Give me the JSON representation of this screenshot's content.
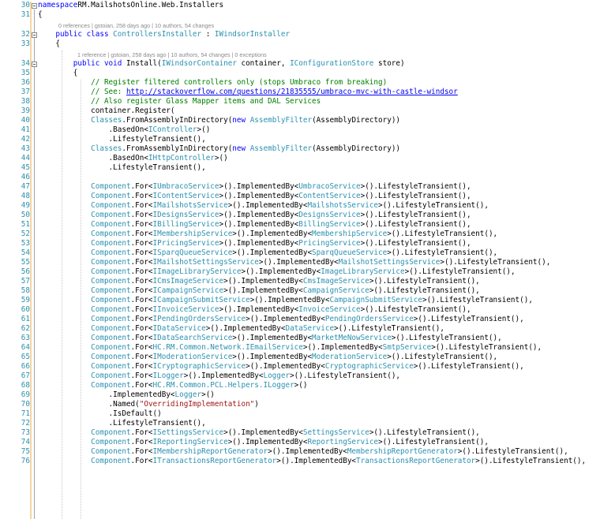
{
  "lines": [
    {
      "n": "30",
      "segs": [
        [
          "k",
          "namespace"
        ],
        [
          "",
          "RM.MailshotsOnline.Web.Installers"
        ]
      ]
    },
    {
      "n": "31",
      "segs": [
        [
          "",
          "{"
        ]
      ]
    },
    {
      "n": "32",
      "segs": [
        [
          "",
          "    "
        ],
        [
          "k",
          "public class"
        ],
        [
          "",
          ""
        ],
        [
          "t",
          "ControllersInstaller"
        ],
        [
          "",
          " : "
        ],
        [
          "t",
          "IWindsorInstaller"
        ]
      ]
    },
    {
      "n": "33",
      "segs": [
        [
          "",
          "    {"
        ]
      ]
    },
    {
      "n": "34",
      "segs": [
        [
          "",
          "        "
        ],
        [
          "k",
          "public void"
        ],
        [
          "",
          " Install("
        ],
        [
          "t",
          "IWindsorContainer"
        ],
        [
          "",
          " container, "
        ],
        [
          "t",
          "IConfigurationStore"
        ],
        [
          "",
          " store)"
        ]
      ]
    },
    {
      "n": "35",
      "segs": [
        [
          "",
          "        {"
        ]
      ]
    },
    {
      "n": "36",
      "segs": [
        [
          "",
          "            "
        ],
        [
          "c",
          "// Register filtered controllers only (stops Umbraco from breaking)"
        ]
      ]
    },
    {
      "n": "37",
      "segs": [
        [
          "",
          "            "
        ],
        [
          "c",
          "// See: "
        ],
        [
          "u",
          "http://stackoverflow.com/questions/21835555/umbraco-mvc-with-castle-windsor"
        ]
      ]
    },
    {
      "n": "38",
      "segs": [
        [
          "",
          "            "
        ],
        [
          "c",
          "// Also register Glass Mapper items and DAL Services"
        ]
      ]
    },
    {
      "n": "39",
      "segs": [
        [
          "",
          "            container.Register("
        ]
      ]
    },
    {
      "n": "40",
      "segs": [
        [
          "",
          "            "
        ],
        [
          "t",
          "Classes"
        ],
        [
          "",
          ".FromAssemblyInDirectory("
        ],
        [
          "k",
          "new"
        ],
        [
          "",
          " "
        ],
        [
          "t",
          "AssemblyFilter"
        ],
        [
          "",
          "(AssemblyDirectory))"
        ]
      ]
    },
    {
      "n": "41",
      "segs": [
        [
          "",
          "                .BasedOn<"
        ],
        [
          "t",
          "IController"
        ],
        [
          "",
          ">()"
        ]
      ]
    },
    {
      "n": "42",
      "segs": [
        [
          "",
          "                .LifestyleTransient(),"
        ]
      ]
    },
    {
      "n": "43",
      "segs": [
        [
          "",
          "            "
        ],
        [
          "t",
          "Classes"
        ],
        [
          "",
          ".FromAssemblyInDirectory("
        ],
        [
          "k",
          "new"
        ],
        [
          "",
          " "
        ],
        [
          "t",
          "AssemblyFilter"
        ],
        [
          "",
          "(AssemblyDirectory))"
        ]
      ]
    },
    {
      "n": "44",
      "segs": [
        [
          "",
          "                .BasedOn<"
        ],
        [
          "t",
          "IHttpController"
        ],
        [
          "",
          ">()"
        ]
      ]
    },
    {
      "n": "45",
      "segs": [
        [
          "",
          "                .LifestyleTransient(),"
        ]
      ]
    },
    {
      "n": "46",
      "segs": [
        [
          "",
          ""
        ]
      ]
    },
    {
      "n": "47",
      "segs": [
        [
          "",
          "            "
        ],
        [
          "t",
          "Component"
        ],
        [
          "",
          ".For<"
        ],
        [
          "t",
          "IUmbracoService"
        ],
        [
          "",
          ">().ImplementedBy<"
        ],
        [
          "t",
          "UmbracoService"
        ],
        [
          "",
          ">().LifestyleTransient(),"
        ]
      ]
    },
    {
      "n": "48",
      "segs": [
        [
          "",
          "            "
        ],
        [
          "t",
          "Component"
        ],
        [
          "",
          ".For<"
        ],
        [
          "t",
          "IContentService"
        ],
        [
          "",
          ">().ImplementedBy<"
        ],
        [
          "t",
          "ContentService"
        ],
        [
          "",
          ">().LifestyleTransient(),"
        ]
      ]
    },
    {
      "n": "49",
      "segs": [
        [
          "",
          "            "
        ],
        [
          "t",
          "Component"
        ],
        [
          "",
          ".For<"
        ],
        [
          "t",
          "IMailshotsService"
        ],
        [
          "",
          ">().ImplementedBy<"
        ],
        [
          "t",
          "MailshotsService"
        ],
        [
          "",
          ">().LifestyleTransient(),"
        ]
      ]
    },
    {
      "n": "50",
      "segs": [
        [
          "",
          "            "
        ],
        [
          "t",
          "Component"
        ],
        [
          "",
          ".For<"
        ],
        [
          "t",
          "IDesignsService"
        ],
        [
          "",
          ">().ImplementedBy<"
        ],
        [
          "t",
          "DesignsService"
        ],
        [
          "",
          ">().LifestyleTransient(),"
        ]
      ]
    },
    {
      "n": "51",
      "segs": [
        [
          "",
          "            "
        ],
        [
          "t",
          "Component"
        ],
        [
          "",
          ".For<"
        ],
        [
          "t",
          "IBillingService"
        ],
        [
          "",
          ">().ImplementedBy<"
        ],
        [
          "t",
          "BillingService"
        ],
        [
          "",
          ">().LifestyleTransient(),"
        ]
      ]
    },
    {
      "n": "52",
      "segs": [
        [
          "",
          "            "
        ],
        [
          "t",
          "Component"
        ],
        [
          "",
          ".For<"
        ],
        [
          "t",
          "IMembershipService"
        ],
        [
          "",
          ">().ImplementedBy<"
        ],
        [
          "t",
          "MembershipService"
        ],
        [
          "",
          ">().LifestyleTransient(),"
        ]
      ]
    },
    {
      "n": "53",
      "segs": [
        [
          "",
          "            "
        ],
        [
          "t",
          "Component"
        ],
        [
          "",
          ".For<"
        ],
        [
          "t",
          "IPricingService"
        ],
        [
          "",
          ">().ImplementedBy<"
        ],
        [
          "t",
          "PricingService"
        ],
        [
          "",
          ">().LifestyleTransient(),"
        ]
      ]
    },
    {
      "n": "54",
      "segs": [
        [
          "",
          "            "
        ],
        [
          "t",
          "Component"
        ],
        [
          "",
          ".For<"
        ],
        [
          "t",
          "ISparqQueueService"
        ],
        [
          "",
          ">().ImplementedBy<"
        ],
        [
          "t",
          "SparqQueueService"
        ],
        [
          "",
          ">().LifestyleTransient(),"
        ]
      ]
    },
    {
      "n": "55",
      "segs": [
        [
          "",
          "            "
        ],
        [
          "t",
          "Component"
        ],
        [
          "",
          ".For<"
        ],
        [
          "t",
          "IMailshotSettingsService"
        ],
        [
          "",
          ">().ImplementedBy<"
        ],
        [
          "t",
          "MailshotSettingsService"
        ],
        [
          "",
          ">().LifestyleTransient(),"
        ]
      ]
    },
    {
      "n": "56",
      "segs": [
        [
          "",
          "            "
        ],
        [
          "t",
          "Component"
        ],
        [
          "",
          ".For<"
        ],
        [
          "t",
          "IImageLibraryService"
        ],
        [
          "",
          ">().ImplementedBy<"
        ],
        [
          "t",
          "ImageLibraryService"
        ],
        [
          "",
          ">().LifestyleTransient(),"
        ]
      ]
    },
    {
      "n": "57",
      "segs": [
        [
          "",
          "            "
        ],
        [
          "t",
          "Component"
        ],
        [
          "",
          ".For<"
        ],
        [
          "t",
          "ICmsImageService"
        ],
        [
          "",
          ">().ImplementedBy<"
        ],
        [
          "t",
          "CmsImageService"
        ],
        [
          "",
          ">().LifestyleTransient(),"
        ]
      ]
    },
    {
      "n": "58",
      "segs": [
        [
          "",
          "            "
        ],
        [
          "t",
          "Component"
        ],
        [
          "",
          ".For<"
        ],
        [
          "t",
          "ICampaignService"
        ],
        [
          "",
          ">().ImplementedBy<"
        ],
        [
          "t",
          "CampaignService"
        ],
        [
          "",
          ">().LifestyleTransient(),"
        ]
      ]
    },
    {
      "n": "59",
      "segs": [
        [
          "",
          "            "
        ],
        [
          "t",
          "Component"
        ],
        [
          "",
          ".For<"
        ],
        [
          "t",
          "ICampaignSubmitService"
        ],
        [
          "",
          ">().ImplementedBy<"
        ],
        [
          "t",
          "CampaignSubmitService"
        ],
        [
          "",
          ">().LifestyleTransient(),"
        ]
      ]
    },
    {
      "n": "60",
      "segs": [
        [
          "",
          "            "
        ],
        [
          "t",
          "Component"
        ],
        [
          "",
          ".For<"
        ],
        [
          "t",
          "IInvoiceService"
        ],
        [
          "",
          ">().ImplementedBy<"
        ],
        [
          "t",
          "InvoiceService"
        ],
        [
          "",
          ">().LifestyleTransient(),"
        ]
      ]
    },
    {
      "n": "61",
      "segs": [
        [
          "",
          "            "
        ],
        [
          "t",
          "Component"
        ],
        [
          "",
          ".For<"
        ],
        [
          "t",
          "IPendingOrdersService"
        ],
        [
          "",
          ">().ImplementedBy<"
        ],
        [
          "t",
          "PendingOrdersService"
        ],
        [
          "",
          ">().LifestyleTransient(),"
        ]
      ]
    },
    {
      "n": "62",
      "segs": [
        [
          "",
          "            "
        ],
        [
          "t",
          "Component"
        ],
        [
          "",
          ".For<"
        ],
        [
          "t",
          "IDataService"
        ],
        [
          "",
          ">().ImplementedBy<"
        ],
        [
          "t",
          "DataService"
        ],
        [
          "",
          ">().LifestyleTransient(),"
        ]
      ]
    },
    {
      "n": "63",
      "segs": [
        [
          "",
          "            "
        ],
        [
          "t",
          "Component"
        ],
        [
          "",
          ".For<"
        ],
        [
          "t",
          "IDataSearchService"
        ],
        [
          "",
          ">().ImplementedBy<"
        ],
        [
          "t",
          "MarketMeNowService"
        ],
        [
          "",
          ">().LifestyleTransient(),"
        ]
      ]
    },
    {
      "n": "64",
      "segs": [
        [
          "",
          "            "
        ],
        [
          "t",
          "Component"
        ],
        [
          "",
          ".For<"
        ],
        [
          "t",
          "HC.RM.Common.Network."
        ],
        [
          "t",
          "IEmailService"
        ],
        [
          "",
          ">().ImplementedBy<"
        ],
        [
          "t",
          "SmtpService"
        ],
        [
          "",
          ">().LifestyleTransient(),"
        ]
      ]
    },
    {
      "n": "65",
      "segs": [
        [
          "",
          "            "
        ],
        [
          "t",
          "Component"
        ],
        [
          "",
          ".For<"
        ],
        [
          "t",
          "IModerationService"
        ],
        [
          "",
          ">().ImplementedBy<"
        ],
        [
          "t",
          "ModerationService"
        ],
        [
          "",
          ">().LifestyleTransient(),"
        ]
      ]
    },
    {
      "n": "66",
      "segs": [
        [
          "",
          "            "
        ],
        [
          "t",
          "Component"
        ],
        [
          "",
          ".For<"
        ],
        [
          "t",
          "ICryptographicService"
        ],
        [
          "",
          ">().ImplementedBy<"
        ],
        [
          "t",
          "CryptographicService"
        ],
        [
          "",
          ">().LifestyleTransient(),"
        ]
      ]
    },
    {
      "n": "67",
      "segs": [
        [
          "",
          "            "
        ],
        [
          "t",
          "Component"
        ],
        [
          "",
          ".For<"
        ],
        [
          "t",
          "ILogger"
        ],
        [
          "",
          ">().ImplementedBy<"
        ],
        [
          "t",
          "Logger"
        ],
        [
          "",
          ">().LifestyleTransient(),"
        ]
      ]
    },
    {
      "n": "68",
      "segs": [
        [
          "",
          "            "
        ],
        [
          "t",
          "Component"
        ],
        [
          "",
          ".For<"
        ],
        [
          "t",
          "HC.RM.Common.PCL.Helpers."
        ],
        [
          "t",
          "ILogger"
        ],
        [
          "",
          ">()"
        ]
      ]
    },
    {
      "n": "69",
      "segs": [
        [
          "",
          "                .ImplementedBy<"
        ],
        [
          "t",
          "Logger"
        ],
        [
          "",
          ">()"
        ]
      ]
    },
    {
      "n": "70",
      "segs": [
        [
          "",
          "                .Named("
        ],
        [
          "s",
          "\"OverridingImplementation\""
        ],
        [
          "",
          ")"
        ]
      ]
    },
    {
      "n": "71",
      "segs": [
        [
          "",
          "                .IsDefault()"
        ]
      ]
    },
    {
      "n": "72",
      "segs": [
        [
          "",
          "                .LifestyleTransient(),"
        ]
      ]
    },
    {
      "n": "73",
      "segs": [
        [
          "",
          "            "
        ],
        [
          "t",
          "Component"
        ],
        [
          "",
          ".For<"
        ],
        [
          "t",
          "ISettingsService"
        ],
        [
          "",
          ">().ImplementedBy<"
        ],
        [
          "t",
          "SettingsService"
        ],
        [
          "",
          ">().LifestyleTransient(),"
        ]
      ]
    },
    {
      "n": "74",
      "segs": [
        [
          "",
          "            "
        ],
        [
          "t",
          "Component"
        ],
        [
          "",
          ".For<"
        ],
        [
          "t",
          "IReportingService"
        ],
        [
          "",
          ">().ImplementedBy<"
        ],
        [
          "t",
          "ReportingService"
        ],
        [
          "",
          ">().LifestyleTransient(),"
        ]
      ]
    },
    {
      "n": "75",
      "segs": [
        [
          "",
          "            "
        ],
        [
          "t",
          "Component"
        ],
        [
          "",
          ".For<"
        ],
        [
          "t",
          "IMembershipReportGenerator"
        ],
        [
          "",
          ">().ImplementedBy<"
        ],
        [
          "t",
          "MembershipReportGenerator"
        ],
        [
          "",
          ">().LifestyleTransient(),"
        ]
      ]
    },
    {
      "n": "76",
      "segs": [
        [
          "",
          "            "
        ],
        [
          "t",
          "Component"
        ],
        [
          "",
          ".For<"
        ],
        [
          "t",
          "ITransactionsReportGenerator"
        ],
        [
          "",
          ">().ImplementedBy<"
        ],
        [
          "t",
          "TransactionsReportGenerator"
        ],
        [
          "",
          ">().LifestyleTransient(),"
        ]
      ]
    }
  ],
  "codelens": {
    "class": "0 references | gstoian, 258 days ago | 10 authors, 54 changes",
    "method": "1 reference | gstoian, 258 days ago | 10 authors, 54 changes | 0 exceptions"
  }
}
